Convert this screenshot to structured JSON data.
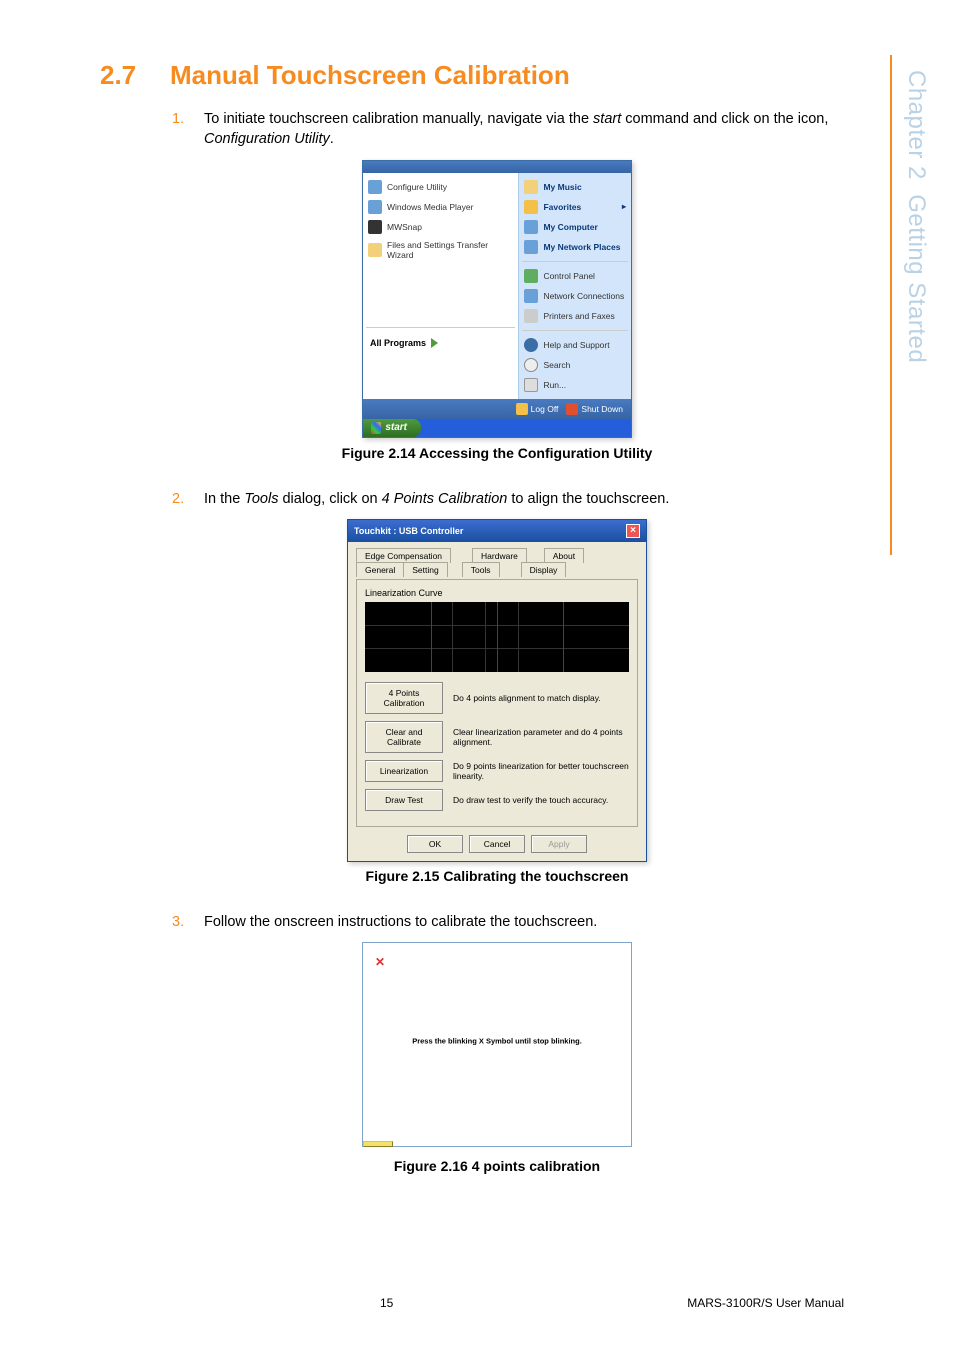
{
  "sidebar": {
    "chapter": "Chapter 2",
    "title": "Getting Started"
  },
  "heading": {
    "num": "2.7",
    "title": "Manual Touchscreen Calibration"
  },
  "steps": {
    "s1": {
      "num": "1.",
      "text_a": "To initiate touchscreen calibration manually, navigate via the ",
      "em1": "start",
      "text_b": " command and click on the icon, ",
      "em2": "Configuration Utility",
      "text_c": "."
    },
    "s2": {
      "num": "2.",
      "text_a": "In the ",
      "em1": "Tools",
      "text_b": " dialog, click on ",
      "em2": "4 Points Calibration",
      "text_c": " to align the touchscreen."
    },
    "s3": {
      "num": "3.",
      "text": "Follow the onscreen instructions to calibrate the touchscreen."
    }
  },
  "captions": {
    "c1": "Figure 2.14 Accessing the Configuration Utility",
    "c2": "Figure 2.15 Calibrating the touchscreen",
    "c3": "Figure 2.16 4 points calibration"
  },
  "startmenu": {
    "left": {
      "items": [
        "Configure Utility",
        "Windows Media Player",
        "MWSnap",
        "Files and Settings Transfer Wizard"
      ],
      "all": "All Programs"
    },
    "right": {
      "bold": [
        "My Music",
        "Favorites",
        "My Computer",
        "My Network Places"
      ],
      "plain1": [
        "Control Panel",
        "Network Connections",
        "Printers and Faxes"
      ],
      "plain2": [
        "Help and Support",
        "Search",
        "Run..."
      ]
    },
    "logoff": {
      "a": "Log Off",
      "b": "Shut Down"
    },
    "start": "start"
  },
  "touchkit": {
    "title": "Touchkit : USB Controller",
    "tabs_top": [
      "Edge Compensation",
      "Hardware",
      "About"
    ],
    "tabs_bot": [
      "General",
      "Setting",
      "Tools",
      "Display"
    ],
    "section": "Linearization Curve",
    "rows": [
      {
        "btn": "4 Points Calibration",
        "desc": "Do 4 points alignment to match display."
      },
      {
        "btn": "Clear and Calibrate",
        "desc": "Clear linearization parameter and do 4 points alignment."
      },
      {
        "btn": "Linearization",
        "desc": "Do 9 points linearization for better touchscreen linearity."
      },
      {
        "btn": "Draw Test",
        "desc": "Do draw test to verify the touch accuracy."
      }
    ],
    "ok": "OK",
    "cancel": "Cancel",
    "apply": "Apply"
  },
  "calib": {
    "text": "Press the blinking X Symbol until stop blinking."
  },
  "footer": {
    "page": "15",
    "doc": "MARS-3100R/S User Manual"
  }
}
